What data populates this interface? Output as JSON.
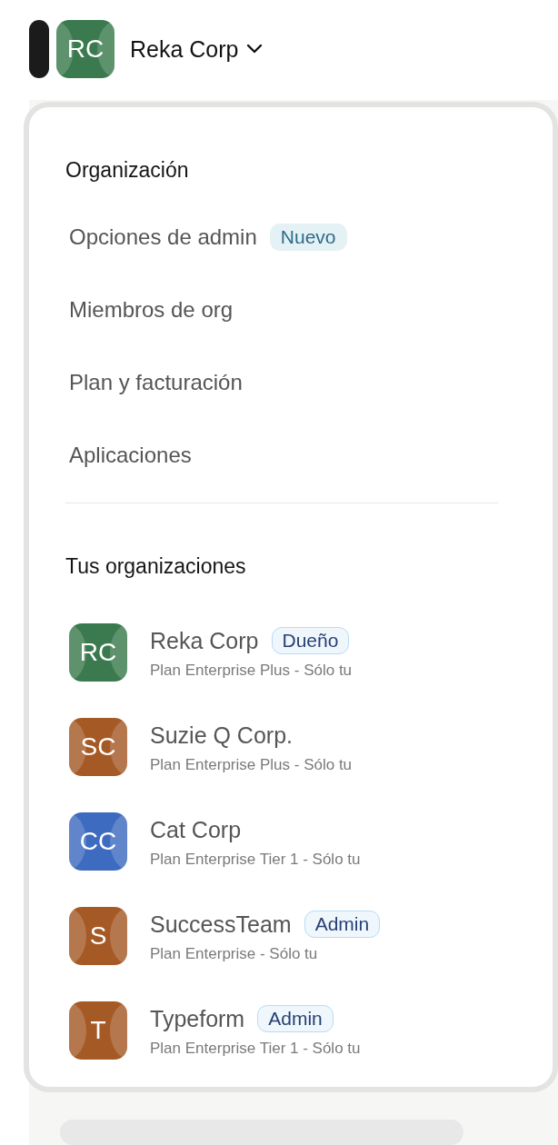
{
  "header": {
    "org_name": "Reka Corp",
    "initials": "RC",
    "color": "#3a7a4e"
  },
  "menu": {
    "org_section": {
      "title": "Organización",
      "items": [
        {
          "label": "Opciones de admin",
          "badge": {
            "text": "Nuevo",
            "kind": "new"
          }
        },
        {
          "label": "Miembros de org"
        },
        {
          "label": "Plan y facturación"
        },
        {
          "label": "Aplicaciones"
        }
      ]
    },
    "orgs_section": {
      "title": "Tus organizaciones",
      "orgs": [
        {
          "initials": "RC",
          "name": "Reka Corp",
          "color": "#3a7a4e",
          "badge": {
            "text": "Dueño",
            "kind": "role"
          },
          "plan": "Plan Enterprise Plus - Sólo tu"
        },
        {
          "initials": "SC",
          "name": "Suzie Q Corp.",
          "color": "#a55a26",
          "plan": "Plan Enterprise Plus - Sólo tu"
        },
        {
          "initials": "CC",
          "name": "Cat Corp",
          "color": "#3d6bbf",
          "plan": "Plan Enterprise Tier 1 - Sólo tu"
        },
        {
          "initials": "S",
          "name": "SuccessTeam",
          "color": "#a55a26",
          "badge": {
            "text": "Admin",
            "kind": "role"
          },
          "plan": "Plan Enterprise - Sólo tu"
        },
        {
          "initials": "T",
          "name": "Typeform",
          "color": "#a55a26",
          "badge": {
            "text": "Admin",
            "kind": "role"
          },
          "plan": "Plan Enterprise Tier 1 - Sólo tu"
        }
      ]
    }
  }
}
